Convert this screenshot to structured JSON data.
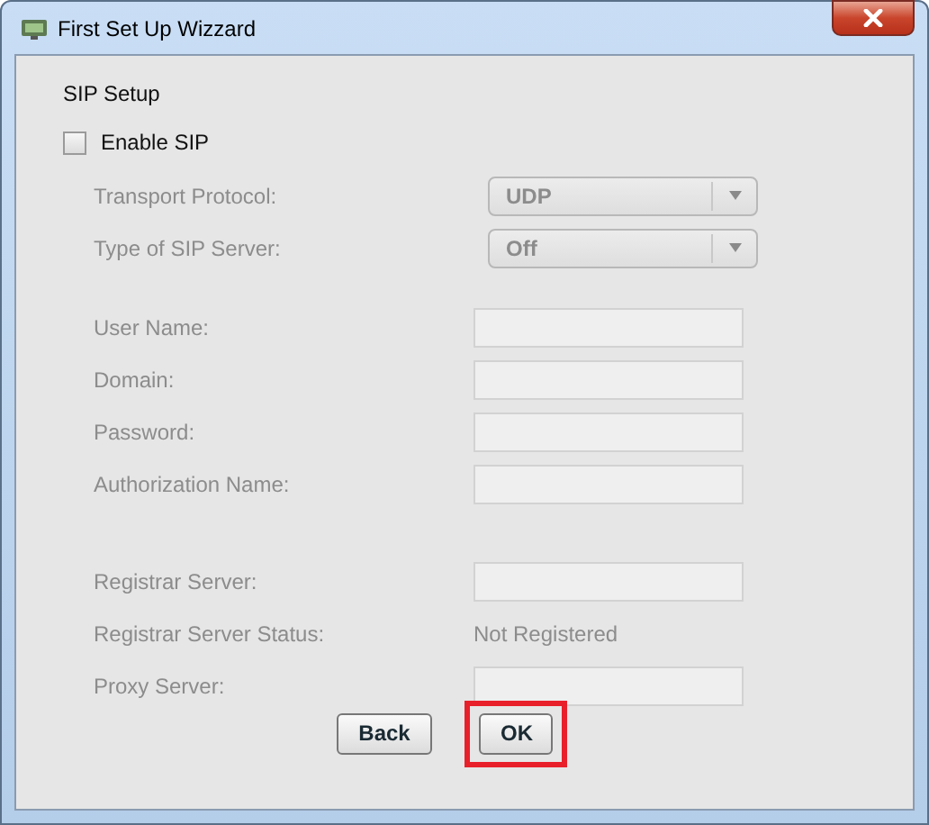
{
  "window": {
    "title": "First Set Up Wizzard"
  },
  "section_title": "SIP Setup",
  "enable_sip": {
    "label": "Enable SIP",
    "checked": false
  },
  "groups": [
    [
      {
        "label": "Transport Protocol:",
        "kind": "dropdown",
        "value": "UDP",
        "disabled": true
      },
      {
        "label": "Type of SIP Server:",
        "kind": "dropdown",
        "value": "Off",
        "disabled": true
      }
    ],
    [
      {
        "label": "User Name:",
        "kind": "text",
        "disabled": true
      },
      {
        "label": "Domain:",
        "kind": "text",
        "disabled": true
      },
      {
        "label": "Password:",
        "kind": "text",
        "disabled": true
      },
      {
        "label": "Authorization Name:",
        "kind": "text",
        "disabled": true
      }
    ],
    [
      {
        "label": "Registrar Server:",
        "kind": "text",
        "disabled": true
      },
      {
        "label": "Registrar Server Status:",
        "kind": "status",
        "value": "Not Registered",
        "disabled": true
      },
      {
        "label": "Proxy Server:",
        "kind": "text",
        "disabled": true
      }
    ]
  ],
  "buttons": [
    {
      "label": "Back",
      "highlighted": false
    },
    {
      "label": "OK",
      "highlighted": true
    }
  ]
}
